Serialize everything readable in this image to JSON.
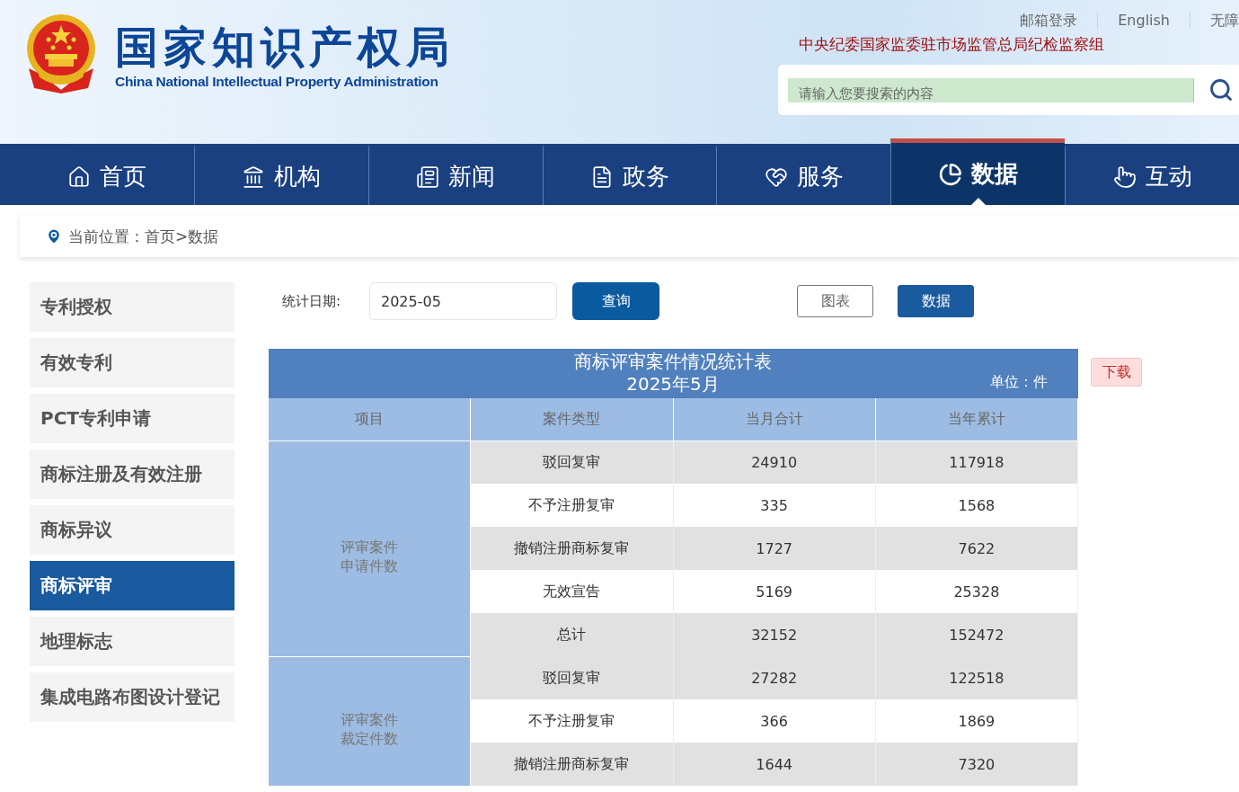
{
  "header": {
    "title": "国家知识产权局",
    "subtitle": "China National Intellectual Property Administration",
    "top_links": [
      "邮箱登录",
      "English",
      "无障"
    ],
    "notice": "中央纪委国家监委驻市场监管总局纪检监察组",
    "search": {
      "placeholder": "请输入您要搜索的内容"
    }
  },
  "nav": [
    {
      "label": "首页",
      "selected": false
    },
    {
      "label": "机构",
      "selected": false
    },
    {
      "label": "新闻",
      "selected": false
    },
    {
      "label": "政务",
      "selected": false
    },
    {
      "label": "服务",
      "selected": false
    },
    {
      "label": "数据",
      "selected": true
    },
    {
      "label": "互动",
      "selected": false
    }
  ],
  "breadcrumb": "当前位置：首页>数据",
  "sidebar": {
    "items": [
      {
        "label": "专利授权",
        "selected": false
      },
      {
        "label": "有效专利",
        "selected": false
      },
      {
        "label": "PCT专利申请",
        "selected": false
      },
      {
        "label": "商标注册及有效注册",
        "selected": false
      },
      {
        "label": "商标异议",
        "selected": false
      },
      {
        "label": "商标评审",
        "selected": true
      },
      {
        "label": "地理标志",
        "selected": false
      },
      {
        "label": "集成电路布图设计登记",
        "selected": false
      }
    ]
  },
  "filter": {
    "label": "统计日期:",
    "value": "2025-05",
    "query_button": "查询"
  },
  "view_toggle": [
    {
      "label": "图表",
      "selected": false
    },
    {
      "label": "数据",
      "selected": true
    }
  ],
  "download_button": "下载",
  "table": {
    "title": "商标评审案件情况统计表",
    "period": "2025年5月",
    "unit": "单位：件",
    "columns": [
      "项目",
      "案件类型",
      "当月合计",
      "当年累计"
    ],
    "groups": [
      {
        "label_lines": [
          "评审案件",
          "申请件数"
        ],
        "rows": [
          {
            "type": "驳回复审",
            "month": "24910",
            "year": "117918"
          },
          {
            "type": "不予注册复审",
            "month": "335",
            "year": "1568"
          },
          {
            "type": "撤销注册商标复审",
            "month": "1727",
            "year": "7622"
          },
          {
            "type": "无效宣告",
            "month": "5169",
            "year": "25328"
          },
          {
            "type": "总计",
            "month": "32152",
            "year": "152472"
          }
        ]
      },
      {
        "label_lines": [
          "评审案件",
          "裁定件数"
        ],
        "rows": [
          {
            "type": "驳回复审",
            "month": "27282",
            "year": "122518"
          },
          {
            "type": "不予注册复审",
            "month": "366",
            "year": "1869"
          },
          {
            "type": "撤销注册商标复审",
            "month": "1644",
            "year": "7320"
          }
        ]
      }
    ]
  }
}
